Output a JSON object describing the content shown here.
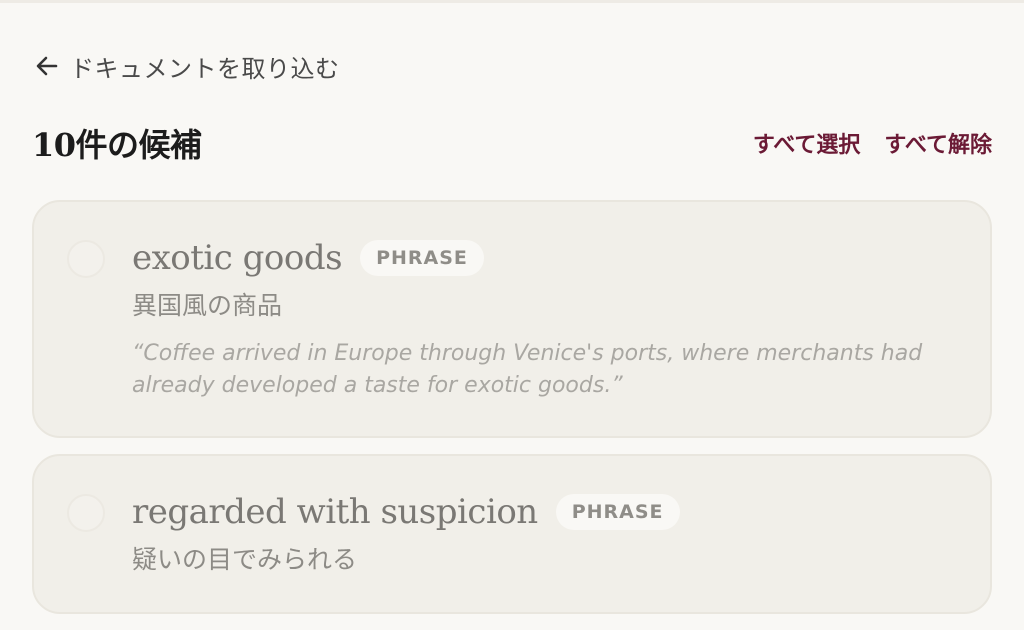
{
  "header": {
    "back_label": "ドキュメントを取り込む",
    "count_title": "10件の候補",
    "select_all": "すべて選択",
    "deselect_all": "すべて解除"
  },
  "candidates": [
    {
      "term": "exotic goods",
      "type": "PHRASE",
      "translation": "異国風の商品",
      "example": "“Coffee arrived in Europe through Venice's ports, where merchants had already developed a taste for exotic goods.”",
      "selected": false
    },
    {
      "term": "regarded with suspicion",
      "type": "PHRASE",
      "translation": "疑いの目でみられる",
      "example": "",
      "selected": false
    }
  ],
  "colors": {
    "accent": "#6b1a35",
    "background": "#f9f8f5",
    "card": "#f1efe9"
  },
  "icons": {
    "back": "arrow-left-icon",
    "checkbox": "checkbox-unchecked-icon"
  }
}
